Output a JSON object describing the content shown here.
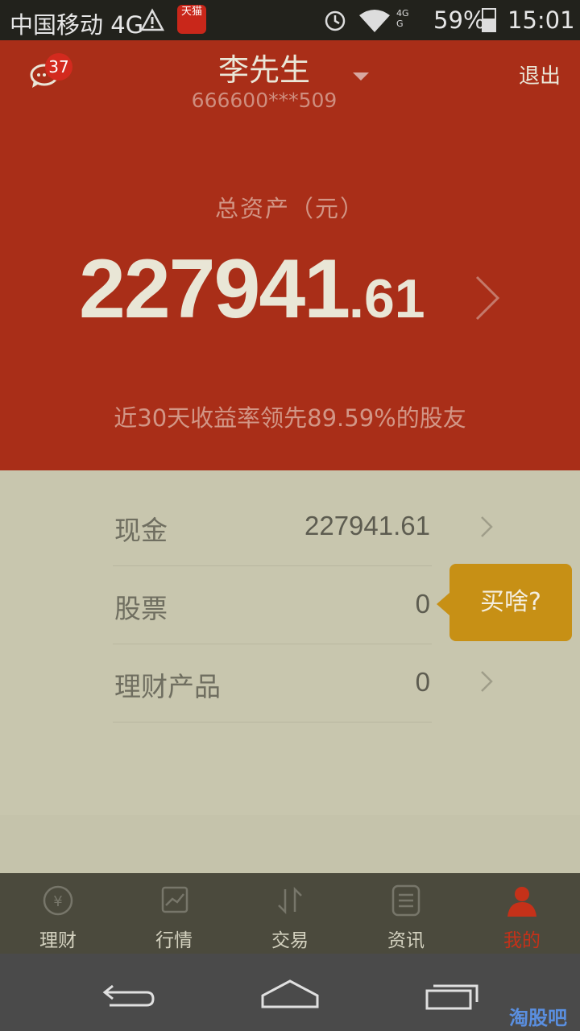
{
  "status_bar": {
    "carrier": "中国移动 4G",
    "signal_top": "4G",
    "signal_bottom": "G",
    "battery_percent": "59%",
    "battery_level": 0.59,
    "time": "15:01",
    "tmall_badge": "天猫"
  },
  "header": {
    "message_badge_count": "37",
    "user_name": "李先生",
    "account_number": "666600***509",
    "logout_label": "退出"
  },
  "assets": {
    "label": "总资产（元）",
    "total_integer": "227941",
    "total_decimal": ".61",
    "ranking_text": "近30天收益率领先89.59%的股友"
  },
  "holdings": [
    {
      "label": "现金",
      "value": "227941.61"
    },
    {
      "label": "股票",
      "value": "0"
    },
    {
      "label": "理财产品",
      "value": "0"
    }
  ],
  "tooltip": {
    "text": "买啥?"
  },
  "tabs": [
    {
      "label": "理财",
      "icon": "yuan-circle-icon"
    },
    {
      "label": "行情",
      "icon": "chart-icon"
    },
    {
      "label": "交易",
      "icon": "trade-arrows-icon"
    },
    {
      "label": "资讯",
      "icon": "news-icon"
    },
    {
      "label": "我的",
      "icon": "person-icon"
    }
  ],
  "watermark": "淘股吧",
  "colors": {
    "header_red": "#a92e18",
    "active_tab": "#c53119",
    "tooltip": "#c79015"
  }
}
